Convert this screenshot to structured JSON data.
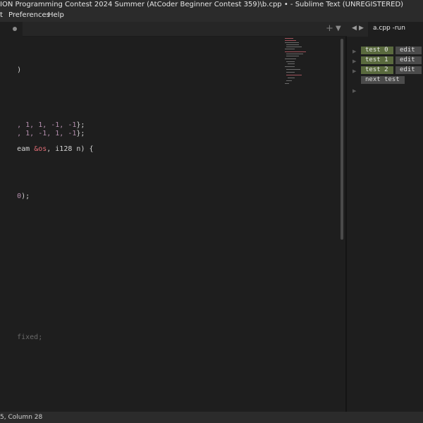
{
  "window": {
    "title": "ION Programming Contest 2024 Summer (AtCoder Beginner Contest 359)\\b.cpp • - Sublime Text (UNREGISTERED)"
  },
  "menu": {
    "items": [
      "t",
      "Preferences",
      "Help"
    ]
  },
  "tabbar": {
    "plus_icon": "+",
    "dropdown_icon": "▼"
  },
  "editor": {
    "lines": {
      "l1": ")",
      "l2_nums": ", 1, 1, -1, -1",
      "l2_end": "};",
      "l3_nums": ", 1, -1, 1, -1",
      "l3_end": "};",
      "l4_a": "eam ",
      "l4_b": "&os",
      "l4_c": ", i128 n) {",
      "l5_a": "0",
      "l5_b": ");",
      "l6": "fixed;"
    }
  },
  "right_tabs": {
    "back_icon": "◀",
    "forward_icon": "▶",
    "active_label": "a.cpp -run"
  },
  "tests": [
    {
      "label": "test 0",
      "edit": "edit"
    },
    {
      "label": "test 1",
      "edit": "edit"
    },
    {
      "label": "test 2",
      "edit": "edit"
    }
  ],
  "next_test_label": "next test",
  "status": {
    "text": "5, Column 28"
  },
  "colors": {
    "test_button": "#5a6a3e",
    "edit_button": "#4b4b4b",
    "number": "#b48ead",
    "keyword": "#e06c75"
  }
}
